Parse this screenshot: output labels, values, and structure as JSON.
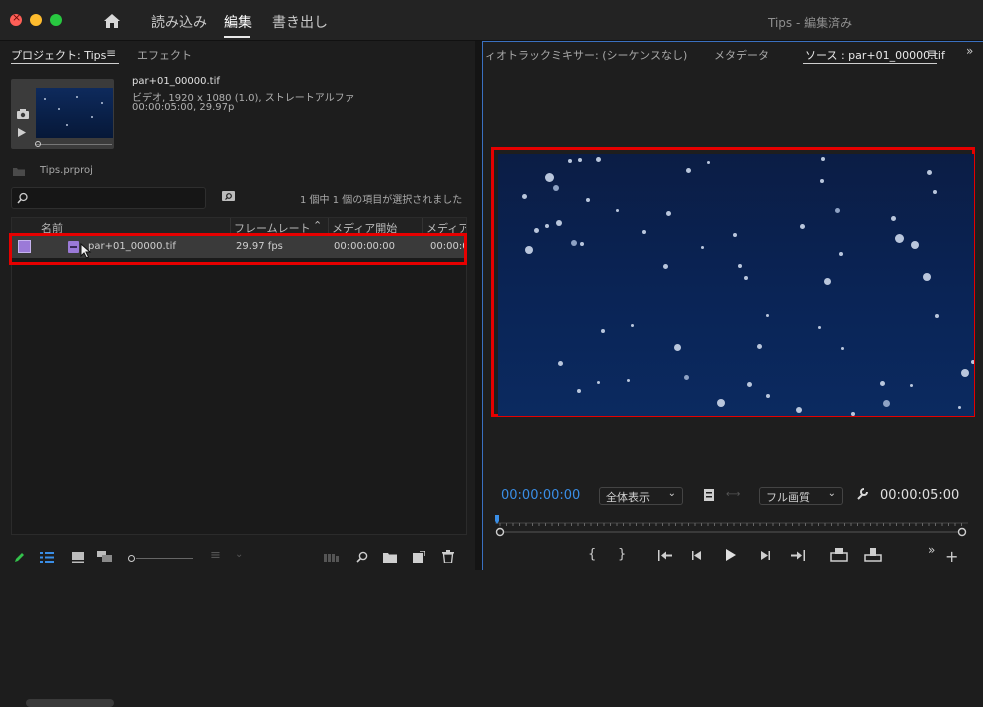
{
  "colors": {
    "accent_blue": "#3a8ee6",
    "highlight_red": "#e60000",
    "clip_purple": "#9b7ad8",
    "traffic_close": "#fe5f57",
    "traffic_min": "#febc2e",
    "traffic_max": "#28c840"
  },
  "topbar": {
    "nav": [
      "読み込み",
      "編集",
      "書き出し"
    ],
    "active_index": 1,
    "window_title": "Tips - 編集済み",
    "home_icon": "home-icon"
  },
  "project": {
    "tabs": [
      "プロジェクト: Tips",
      "エフェクト"
    ],
    "clip_name": "par+01_00000.tif",
    "clip_info_1": "ビデオ, 1920 x 1080 (1.0), ストレートアルファ",
    "clip_info_2": "00:00:05:00, 29.97p",
    "project_file": "Tips.prproj",
    "search_placeholder": "",
    "selection_status": "1 個中 1 個の項目が選択されました",
    "columns": [
      "名前",
      "フレームレート",
      "メディア開始",
      "メディア"
    ],
    "rows": [
      {
        "name": "par+01_00000.tif",
        "fps": "29.97 fps",
        "start": "00:00:00:00",
        "media": "00:00:0"
      }
    ]
  },
  "source": {
    "tabs": [
      "ィオトラックミキサー: (シーケンスなし)",
      "メタデータ",
      "ソース : par+01_00000.tif"
    ],
    "current_tc": "00:00:00:00",
    "zoom": "全体表示",
    "quality": "フル画質",
    "duration_tc": "00:00:05:00"
  }
}
